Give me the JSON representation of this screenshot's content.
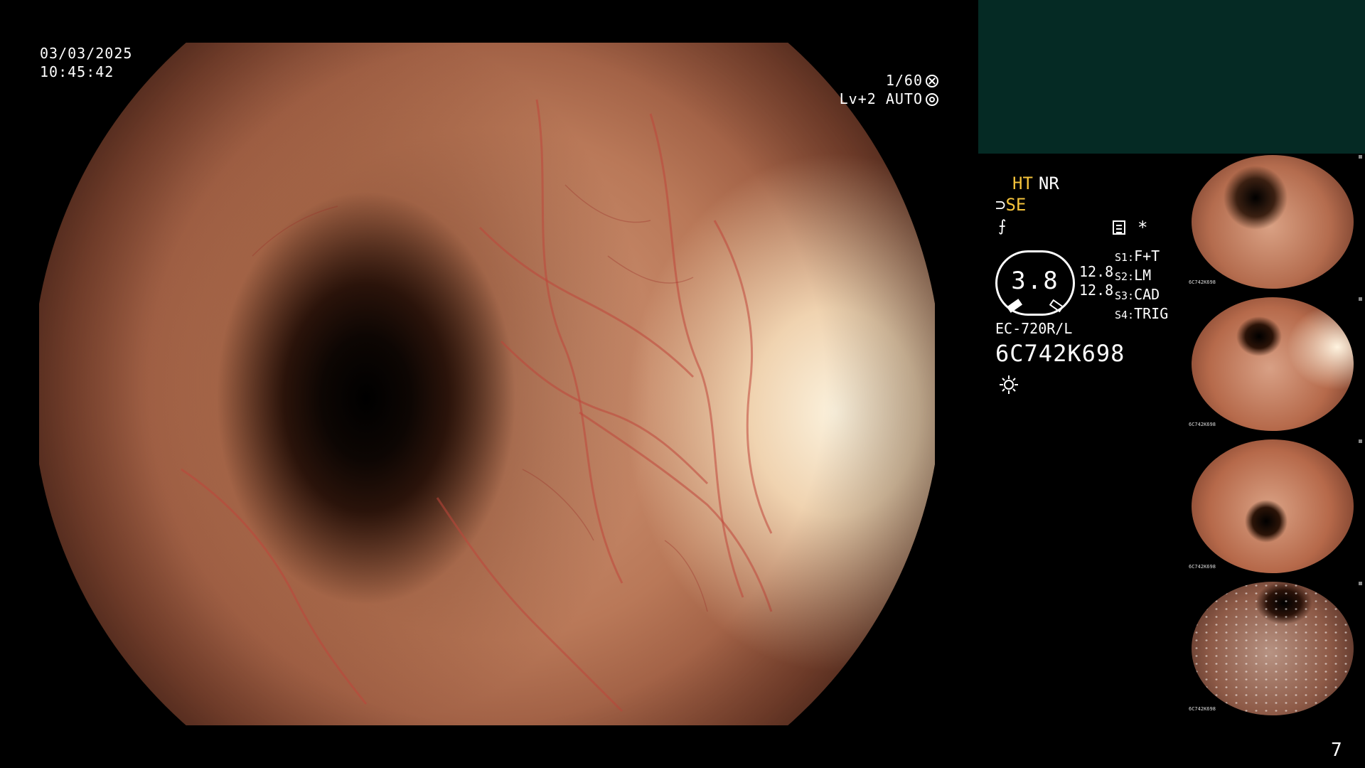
{
  "header": {
    "date": "03/03/2025",
    "time": "10:45:42"
  },
  "exposure": {
    "shutter": "1/60",
    "level": "Lv+2",
    "mode": "AUTO"
  },
  "modes": {
    "ht": "HT",
    "nr": "NR",
    "se": "SE",
    "se_prefix": "⊃"
  },
  "indicator": {
    "gauge_value": "3.8",
    "val1": "12.8",
    "val2": "12.8"
  },
  "scope_buttons": [
    {
      "key": "S1:",
      "value": "F+T"
    },
    {
      "key": "S2:",
      "value": "LM"
    },
    {
      "key": "S3:",
      "value": "CAD"
    },
    {
      "key": "S4:",
      "value": "TRIG"
    }
  ],
  "device": {
    "model": "EC-720R/L",
    "serial": "6C742K698"
  },
  "symbols": {
    "star": "*",
    "slash": "⨍"
  },
  "thumbnails": [
    {
      "tag": "6C742K698"
    },
    {
      "tag": "6C742K698"
    },
    {
      "tag": "6C742K698"
    },
    {
      "tag": "6C742K698"
    }
  ],
  "page_number": "7",
  "colors": {
    "highlight": "#f5c33b",
    "panel": "#052a24"
  }
}
